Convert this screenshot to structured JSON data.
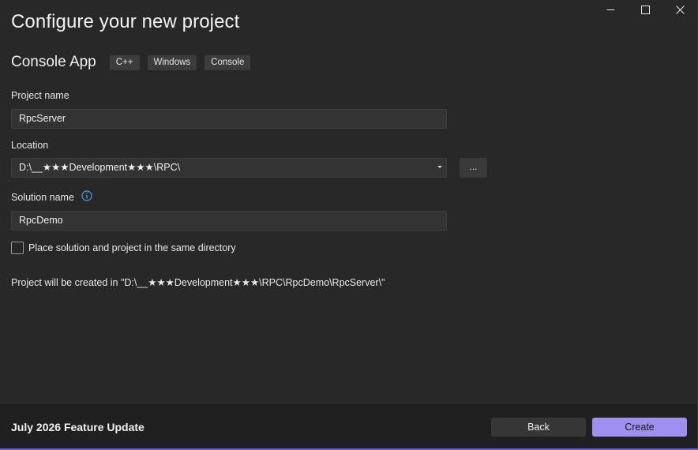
{
  "window": {
    "controls": [
      "minimize",
      "maximize",
      "close"
    ]
  },
  "header": {
    "title": "Configure your new project"
  },
  "template": {
    "name": "Console App",
    "tags": [
      "C++",
      "Windows",
      "Console"
    ]
  },
  "project_name": {
    "label": "Project name",
    "value": "RpcServer"
  },
  "location": {
    "label": "Location",
    "value": "D:\\__★★★Development★★★\\RPC\\",
    "browse_label": "..."
  },
  "solution_name": {
    "label": "Solution name",
    "value": "RpcDemo"
  },
  "same_directory": {
    "label": "Place solution and project in the same directory",
    "checked": false
  },
  "created_in": "Project will be created in \"D:\\__★★★Development★★★\\RPC\\RpcDemo\\RpcServer\\\"",
  "footer": {
    "title": "July 2026 Feature Update",
    "back_label": "Back",
    "create_label": "Create"
  },
  "colors": {
    "accent": "#9f8ff0",
    "background": "#282828",
    "footer": "#202020"
  }
}
